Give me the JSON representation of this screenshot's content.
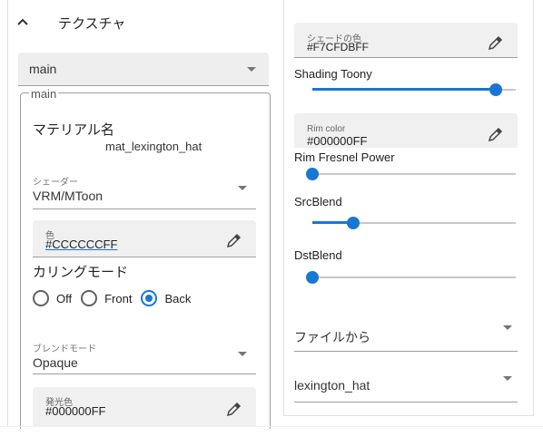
{
  "texture_section": {
    "title": "テクスチャ",
    "material_select": "main",
    "group_legend": "main"
  },
  "material": {
    "name_label": "マテリアル名",
    "name_value": "mat_lexington_hat",
    "shader_label": "シェーダー",
    "shader_value": "VRM/MToon",
    "color_label": "色",
    "color_value": "#CCCCCCFF",
    "culling_label": "カリングモード",
    "culling_options": [
      "Off",
      "Front",
      "Back"
    ],
    "culling_selected": "Back",
    "blend_label": "ブレンドモード",
    "blend_value": "Opaque",
    "emission_label": "発光色",
    "emission_value": "#000000FF"
  },
  "right": {
    "shade_label": "シェードの色",
    "shade_value": "#F7CFDBFF",
    "shading_toony_label": "Shading Toony",
    "shading_toony_value": 0.9,
    "rim_color_label": "Rim color",
    "rim_color_value": "#000000FF",
    "rim_fresnel_label": "Rim Fresnel Power",
    "rim_fresnel_value": 0.0,
    "src_blend_label": "SrcBlend",
    "src_blend_value": 0.2,
    "dst_blend_label": "DstBlend",
    "dst_blend_value": 0.0,
    "file_select": "ファイルから",
    "texture_select": "lexington_hat"
  },
  "colors": {
    "accent": "#1976d2"
  }
}
